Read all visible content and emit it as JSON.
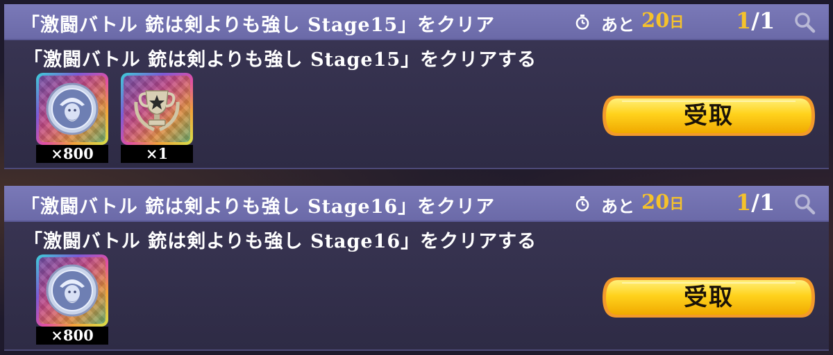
{
  "missions": [
    {
      "header_title": "「激闘バトル 銃は剣よりも強し Stage15」をクリア",
      "remaining_prefix": "あと",
      "remaining_days": "20",
      "remaining_unit": "日",
      "progress_current": "1",
      "progress_total": "/1",
      "description": "「激闘バトル 銃は剣よりも強し Stage15」をクリアする",
      "rewards": [
        {
          "icon": "medal-icon",
          "count": "×800"
        },
        {
          "icon": "trophy-icon",
          "count": "×1"
        }
      ],
      "claim_label": "受取"
    },
    {
      "header_title": "「激闘バトル 銃は剣よりも強し Stage16」をクリア",
      "remaining_prefix": "あと",
      "remaining_days": "20",
      "remaining_unit": "日",
      "progress_current": "1",
      "progress_total": "/1",
      "description": "「激闘バトル 銃は剣よりも強し Stage16」をクリアする",
      "rewards": [
        {
          "icon": "medal-icon",
          "count": "×800"
        }
      ],
      "claim_label": "受取"
    }
  ],
  "colors": {
    "header_bg": "#6b6aa8",
    "body_bg": "#2e2b45",
    "accent_gold": "#f5c22b",
    "button_yellow": "#ffd21c"
  }
}
